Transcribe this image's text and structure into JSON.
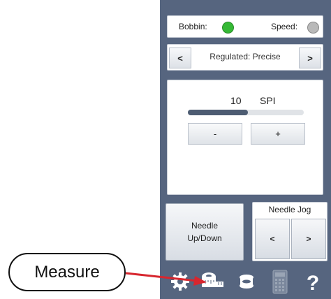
{
  "status": {
    "bobbin_label": "Bobbin:",
    "speed_label": "Speed:",
    "bobbin_color": "#35b935",
    "speed_color": "#b9b9b9"
  },
  "mode": {
    "prev": "<",
    "text": "Regulated: Precise",
    "next": ">"
  },
  "stitch": {
    "value": "10",
    "unit": "SPI",
    "level_fraction": 0.52,
    "minus": "-",
    "plus": "+"
  },
  "needle": {
    "label": "Needle\nUp/Down"
  },
  "jog": {
    "title": "Needle Jog",
    "left": "<",
    "right": ">"
  },
  "toolbar": {
    "icons": [
      "gear-icon",
      "measure-icon",
      "bobbin-icon",
      "calculator-icon",
      "help-icon"
    ],
    "help": "?"
  },
  "annotation": {
    "text": "Measure",
    "color": "#d7262e"
  }
}
